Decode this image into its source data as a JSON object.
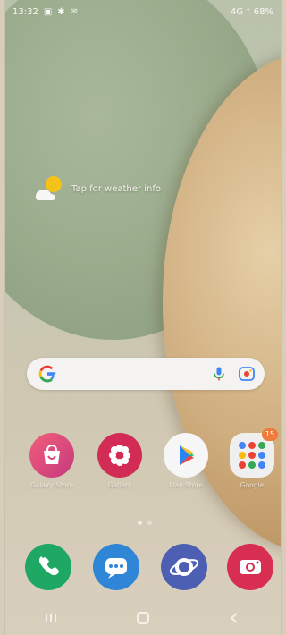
{
  "status": {
    "time": "13:32",
    "right_text": "4G ⁺ 68%"
  },
  "weather": {
    "text": "Tap for weather info"
  },
  "search": {
    "placeholder": ""
  },
  "apps": [
    {
      "name": "Galaxy Store",
      "color": "#e0528d",
      "icon": "shopping-bag-icon"
    },
    {
      "name": "Gallery",
      "color": "#d22b55",
      "icon": "gallery-flower-icon"
    },
    {
      "name": "Play Store",
      "color": "#f6f6f6",
      "icon": "play-store-icon"
    },
    {
      "name": "Google",
      "color": "#f0f0f0",
      "icon": "google-folder-icon",
      "badge": "15"
    }
  ],
  "dock": [
    {
      "name": "Phone",
      "color": "#1fa863",
      "icon": "phone-icon"
    },
    {
      "name": "Messages",
      "color": "#2f86d6",
      "icon": "messages-icon"
    },
    {
      "name": "Internet",
      "color": "#4d5fb3",
      "icon": "internet-planet-icon"
    },
    {
      "name": "Camera",
      "color": "#d82e51",
      "icon": "camera-icon"
    }
  ],
  "colors": {
    "status_text": "#ffffff",
    "search_bg": "#f4f3f1",
    "badge": "#ef7a3b"
  }
}
